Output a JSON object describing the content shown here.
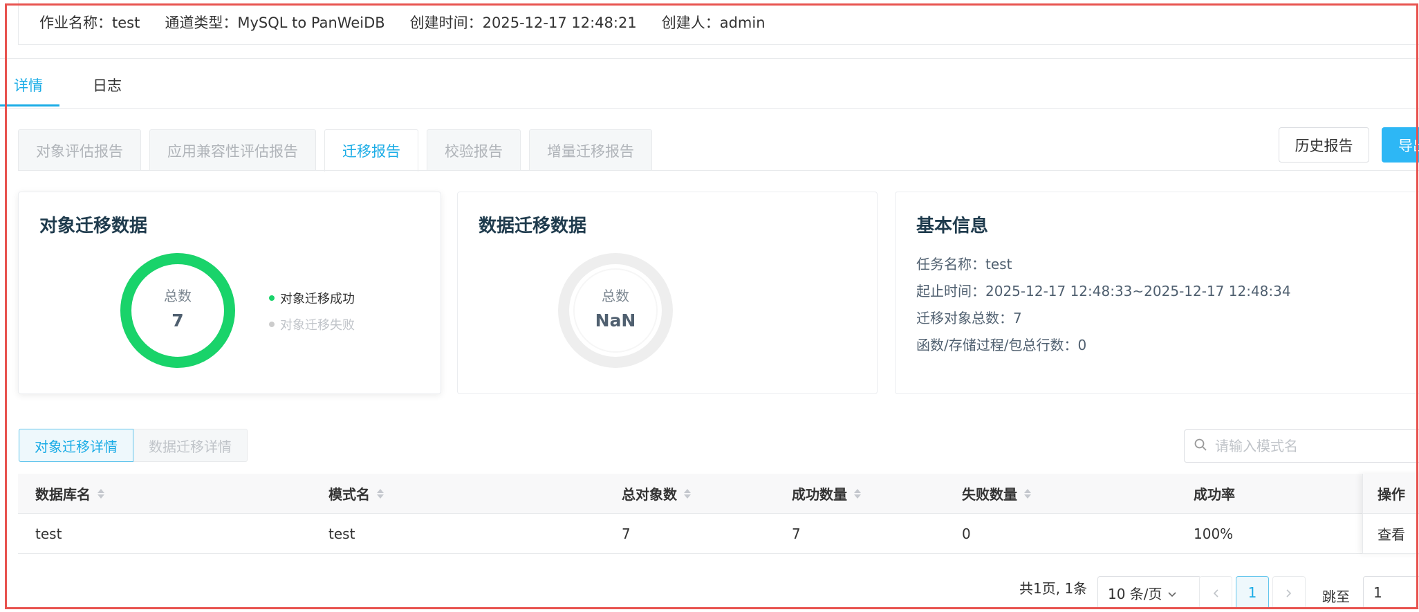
{
  "job": {
    "name_label": "作业名称：test",
    "channel_label": "通道类型：MySQL to PanWeiDB",
    "created_label": "创建时间：2025-12-17 12:48:21",
    "creator_label": "创建人：admin"
  },
  "main_tabs": [
    {
      "label": "详情",
      "active": true
    },
    {
      "label": "日志",
      "active": false
    }
  ],
  "report_tabs": [
    {
      "label": "对象评估报告",
      "active": false
    },
    {
      "label": "应用兼容性评估报告",
      "active": false
    },
    {
      "label": "迁移报告",
      "active": true
    },
    {
      "label": "校验报告",
      "active": false
    },
    {
      "label": "增量迁移报告",
      "active": false
    }
  ],
  "actions": {
    "history": "历史报告",
    "export": "导出"
  },
  "object_card": {
    "title": "对象迁移数据",
    "total_label": "总数",
    "total_value": "7",
    "success_fraction": 1.0,
    "legend": [
      {
        "label": "对象迁移成功",
        "color": "#19d36a"
      },
      {
        "label": "对象迁移失败",
        "color": "#cccccc"
      }
    ]
  },
  "data_card": {
    "title": "数据迁移数据",
    "total_label": "总数",
    "total_value": "NaN"
  },
  "basic_info": {
    "title": "基本信息",
    "task_name": "任务名称：test",
    "time_range": "起止时间：2025-12-17 12:48:33~2025-12-17 12:48:34",
    "total_objects": "迁移对象总数：7",
    "func_rows": "函数/存储过程/包总行数：0"
  },
  "sub_tabs": [
    {
      "label": "对象迁移详情",
      "active": true
    },
    {
      "label": "数据迁移详情",
      "active": false
    }
  ],
  "search": {
    "placeholder": "请输入模式名"
  },
  "table": {
    "headers": [
      "数据库名",
      "模式名",
      "总对象数",
      "成功数量",
      "失败数量",
      "成功率",
      "操作"
    ],
    "rows": [
      {
        "db": "test",
        "schema": "test",
        "total": "7",
        "success": "7",
        "failed": "0",
        "rate": "100%",
        "action": "查看"
      }
    ]
  },
  "pager": {
    "summary": "共1页, 1条",
    "page_size": "10 条/页",
    "current_page": "1",
    "jump_label": "跳至",
    "jump_value": "1"
  },
  "colors": {
    "accent": "#1aace6",
    "success": "#19d36a",
    "frame": "#e8534f"
  }
}
